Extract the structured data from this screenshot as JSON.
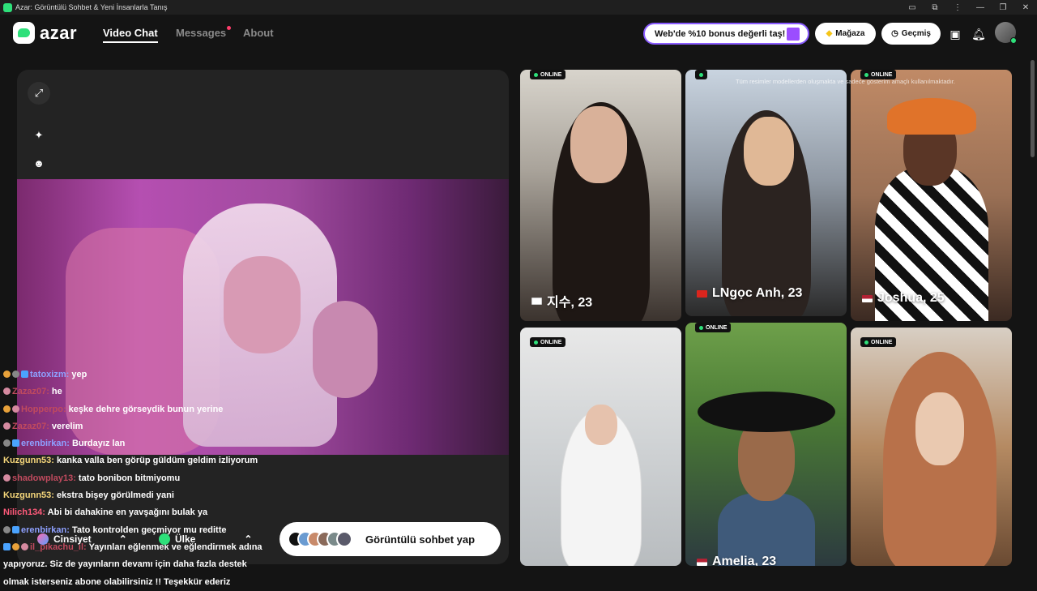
{
  "window": {
    "title": "Azar: Görüntülü Sohbet & Yeni İnsanlarla Tanış"
  },
  "nav": {
    "logo": "azar",
    "links": [
      {
        "label": "Video Chat"
      },
      {
        "label": "Messages"
      },
      {
        "label": "About"
      }
    ],
    "promo": "Web'de %10 bonus değerli taş!",
    "store": "Mağaza",
    "history": "Geçmiş"
  },
  "chat": [
    {
      "user": "tatoxizm:",
      "text": "yep"
    },
    {
      "user": "Zazaz07:",
      "text": "he"
    },
    {
      "user": "Hopperpo:",
      "text": "keşke dehre görseydik bunun yerine"
    },
    {
      "user": "Zazaz07:",
      "text": "verelim"
    },
    {
      "user": "erenbirkan:",
      "text": "Burdayız lan"
    },
    {
      "user": "Kuzgunn53:",
      "text": "kanka valla ben görüp güldüm geldim izliyorum"
    },
    {
      "user": "shadowplay13:",
      "text": "tato bonibon bitmiyomu"
    },
    {
      "user": "Kuzgunn53:",
      "text": "ekstra bişey görülmedi yani"
    },
    {
      "user": "Nilich134:",
      "text": "Abi bi dahakine en yavşağını bulak ya"
    },
    {
      "user": "erenbirkan:",
      "text": "Tato kontrolden geçmiyor mu reditte"
    },
    {
      "user": "il_pikachu_il:",
      "text": "Yayınları eğlenmek ve eğlendirmek adına"
    },
    {
      "user": "",
      "text": "yapıyoruz. Siz de yayınların devamı için daha fazla destek"
    },
    {
      "user": "",
      "text": "olmak isterseniz abone olabilirsiniz !! Teşekkür ederiz"
    }
  ],
  "filters": {
    "gender": "Cinsiyet",
    "country": "Ülke"
  },
  "cta": {
    "label": "Görüntülü sohbet yap"
  },
  "grid": {
    "disclaimer": "Tüm resimler modellerden oluşmakta ve sadece gösterim amaçlı kullanılmaktadır.",
    "online_label": "ONLINE",
    "cards": [
      {
        "name": "지수, 23"
      },
      {
        "name": "LNgọc Anh, 23"
      },
      {
        "name": "Joshua, 25"
      },
      {
        "name": ""
      },
      {
        "name": "Amelia, 23"
      },
      {
        "name": ""
      }
    ]
  },
  "colors": {
    "accent_green": "#2ee07a",
    "promo_border": "#8a5cff",
    "background": "#141414"
  }
}
